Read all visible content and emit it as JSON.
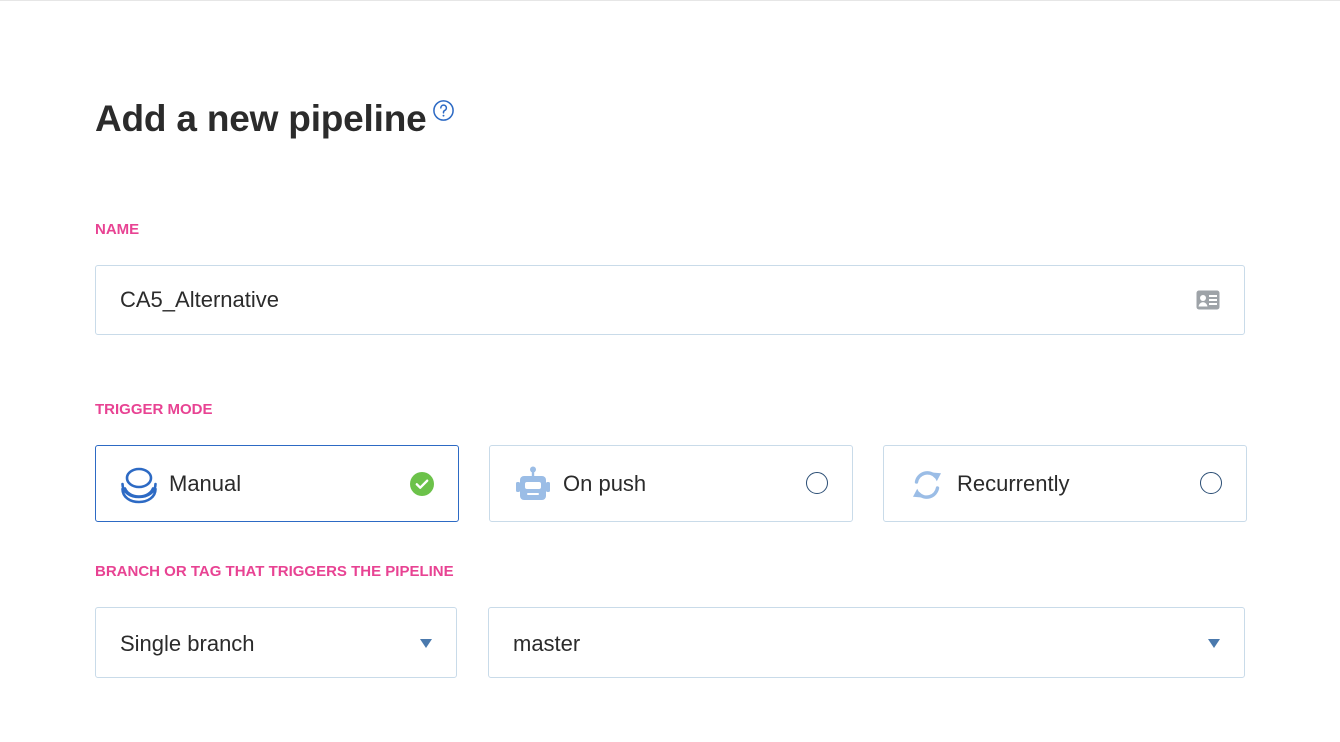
{
  "page": {
    "title": "Add a new pipeline",
    "help_icon": "question-circle-icon"
  },
  "name_section": {
    "label": "NAME",
    "value": "CA5_Alternative",
    "icon": "contact-card-icon"
  },
  "trigger_section": {
    "label": "TRIGGER MODE",
    "options": [
      {
        "label": "Manual",
        "icon": "manual-stack-icon",
        "selected": true
      },
      {
        "label": "On push",
        "icon": "robot-icon",
        "selected": false
      },
      {
        "label": "Recurrently",
        "icon": "refresh-icon",
        "selected": false
      }
    ]
  },
  "branch_section": {
    "label": "BRANCH OR TAG THAT TRIGGERS THE PIPELINE",
    "mode_select": {
      "value": "Single branch"
    },
    "branch_select": {
      "value": "master"
    }
  },
  "colors": {
    "accent_label": "#e84393",
    "selected_border": "#2d6ac4",
    "check_green": "#6cc24a",
    "field_border": "#c9dbe9"
  }
}
